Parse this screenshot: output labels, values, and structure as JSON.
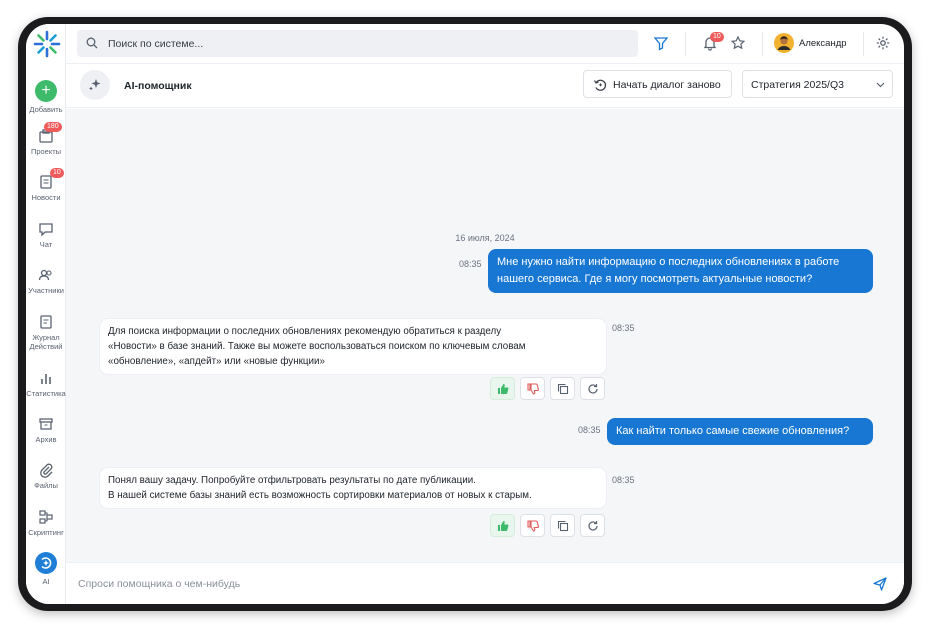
{
  "app": {
    "accent": "#1877d2"
  },
  "topbar": {
    "search_placeholder": "Поиск по системе...",
    "notifications_badge": "10",
    "user_name": "Александр"
  },
  "sidebar": {
    "items": [
      {
        "label": "Добавить",
        "icon": "plus-icon"
      },
      {
        "label": "Проекты",
        "icon": "projects-icon",
        "badge": "180"
      },
      {
        "label": "Новости",
        "icon": "news-icon",
        "badge": "10"
      },
      {
        "label": "Чат",
        "icon": "chat-icon"
      },
      {
        "label": "Участники",
        "icon": "users-icon"
      },
      {
        "label": "Журнал",
        "label2": "Действий",
        "icon": "journal-icon"
      },
      {
        "label": "Статистика",
        "icon": "stats-icon"
      },
      {
        "label": "Архив",
        "icon": "archive-icon"
      },
      {
        "label": "Файлы",
        "icon": "paperclip-icon"
      },
      {
        "label": "Скриптинг",
        "icon": "scripting-icon"
      },
      {
        "label": "AI",
        "icon": "ai-icon"
      }
    ]
  },
  "chat_header": {
    "title": "AI-помощник",
    "restart_label": "Начать диалог заново",
    "strategy_value": "Стратегия 2025/Q3"
  },
  "chat": {
    "date": "16 июля, 2024",
    "messages": [
      {
        "role": "user",
        "time": "08:35",
        "lines": [
          "Мне нужно найти информацию о последних обновлениях в работе",
          "нашего сервиса. Где я могу посмотреть актуальные новости?"
        ]
      },
      {
        "role": "bot",
        "time": "08:35",
        "lines": [
          "Для поиска информации о последних обновлениях рекомендую обратиться к разделу",
          "«Новости» в базе знаний. Также вы можете воспользоваться поиском по ключевым словам",
          "«обновление», «апдейт» или «новые функции»"
        ]
      },
      {
        "role": "user",
        "time": "08:35",
        "lines": [
          "Как найти только самые свежие обновления?"
        ]
      },
      {
        "role": "bot",
        "time": "08:35",
        "lines": [
          "Понял вашу задачу. Попробуйте отфильтровать результаты по дате публикации.",
          "В нашей системе базы знаний есть возможность сортировки материалов от новых к старым."
        ]
      }
    ]
  },
  "input": {
    "placeholder": "Спроси помощника о чем-нибудь"
  }
}
